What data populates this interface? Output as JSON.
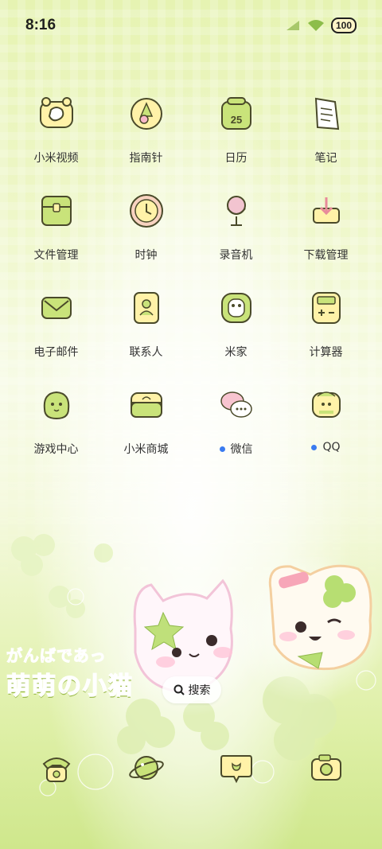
{
  "status_bar": {
    "time": "8:16",
    "battery": "100",
    "signal_icon": "signal-bars-icon",
    "wifi_icon": "wifi-icon"
  },
  "apps": [
    {
      "label": "小米视频",
      "icon": "video-icon",
      "dot": false
    },
    {
      "label": "指南针",
      "icon": "compass-icon",
      "dot": false
    },
    {
      "label": "日历",
      "icon": "calendar-icon",
      "dot": false,
      "calendar_day": "25"
    },
    {
      "label": "笔记",
      "icon": "notes-icon",
      "dot": false
    },
    {
      "label": "文件管理",
      "icon": "folder-icon",
      "dot": false
    },
    {
      "label": "时钟",
      "icon": "clock-icon",
      "dot": false
    },
    {
      "label": "录音机",
      "icon": "microphone-icon",
      "dot": false
    },
    {
      "label": "下载管理",
      "icon": "download-icon",
      "dot": false
    },
    {
      "label": "电子邮件",
      "icon": "mail-icon",
      "dot": false
    },
    {
      "label": "联系人",
      "icon": "contacts-icon",
      "dot": false
    },
    {
      "label": "米家",
      "icon": "mijia-icon",
      "dot": false
    },
    {
      "label": "计算器",
      "icon": "calculator-icon",
      "dot": false
    },
    {
      "label": "游戏中心",
      "icon": "game-center-icon",
      "dot": false
    },
    {
      "label": "小米商城",
      "icon": "mall-icon",
      "dot": false
    },
    {
      "label": "微信",
      "icon": "wechat-icon",
      "dot": true
    },
    {
      "label": "QQ",
      "icon": "qq-icon",
      "dot": true
    }
  ],
  "search": {
    "label": "搜索",
    "icon": "search-icon"
  },
  "wallpaper_text": {
    "line1": "がんばであっ",
    "line2": "萌萌の小猫"
  },
  "dock": [
    {
      "icon": "phone-icon"
    },
    {
      "icon": "browser-planet-icon"
    },
    {
      "icon": "messages-icon"
    },
    {
      "icon": "camera-icon"
    }
  ],
  "colors": {
    "accent_green": "#c9e37a",
    "icon_outline": "#4a4a2a",
    "notify_dot": "#3a7bf0"
  }
}
